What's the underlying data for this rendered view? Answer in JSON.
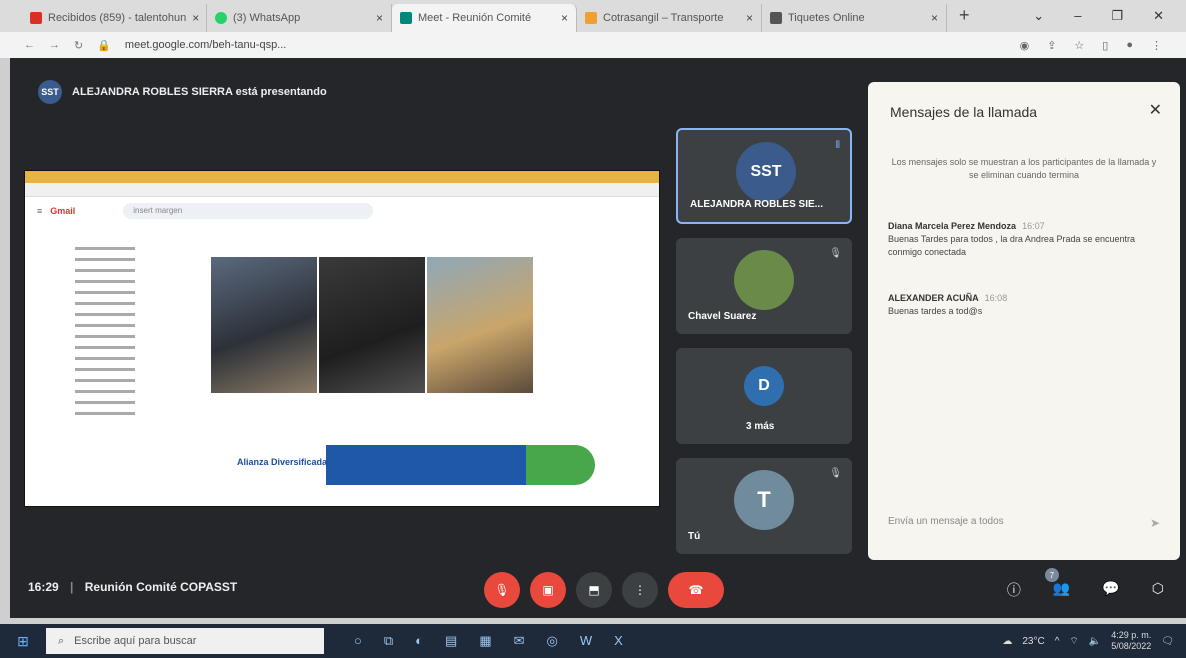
{
  "browser": {
    "tabs": [
      {
        "title": "Recibidos (859) - talentohun",
        "color": "#d93025"
      },
      {
        "title": "(3) WhatsApp",
        "color": "#25d366"
      },
      {
        "title": "Meet - Reunión Comité",
        "color": "#00897b"
      },
      {
        "title": "Cotrasangil – Transporte",
        "color": "#f0a030"
      },
      {
        "title": "Tiquetes Online",
        "color": "#555555"
      }
    ],
    "url": "meet.google.com/beh-tanu-qsp..."
  },
  "meet": {
    "presenting_text": "ALEJANDRA ROBLES SIERRA está presentando",
    "presenter_badge": "SST",
    "shared_screen": {
      "app": "Gmail",
      "search_text": "insert margen",
      "banner_company": "Alianza Diversificada"
    },
    "tiles": [
      {
        "name": "ALEJANDRA ROBLES SIE...",
        "avatar_text": "SST",
        "avatar_color": "#3a5b8c"
      },
      {
        "name": "Chavel Suarez",
        "avatar_text": "",
        "avatar_color": "#6a8a4a"
      },
      {
        "name": "3 más",
        "avatar_text": "D",
        "avatar_color": "#2f6fb0"
      },
      {
        "name": "Tú",
        "avatar_text": "T",
        "avatar_color": "#6f8b9c"
      }
    ],
    "chat": {
      "title": "Mensajes de la llamada",
      "notice": "Los mensajes solo se muestran a los participantes de la llamada y se eliminan cuando termina",
      "messages": [
        {
          "sender": "Diana Marcela Perez Mendoza",
          "time": "16:07",
          "text": "Buenas Tardes para todos , la dra Andrea Prada se encuentra conmigo conectada"
        },
        {
          "sender": "ALEXANDER ACUÑA",
          "time": "16:08",
          "text": "Buenas tardes a tod@s"
        }
      ],
      "input_placeholder": "Envía un mensaje a todos"
    },
    "bottom": {
      "time": "16:29",
      "meeting_name": "Reunión Comité COPASST",
      "participants_count": "7"
    }
  },
  "taskbar": {
    "search_placeholder": "Escribe aquí para buscar",
    "temperature": "23°C",
    "time": "4:29 p. m.",
    "date": "5/08/2022"
  },
  "colors": {
    "meet_bg": "#242629",
    "leave": "#e8493c",
    "tile": "#3c4043"
  }
}
